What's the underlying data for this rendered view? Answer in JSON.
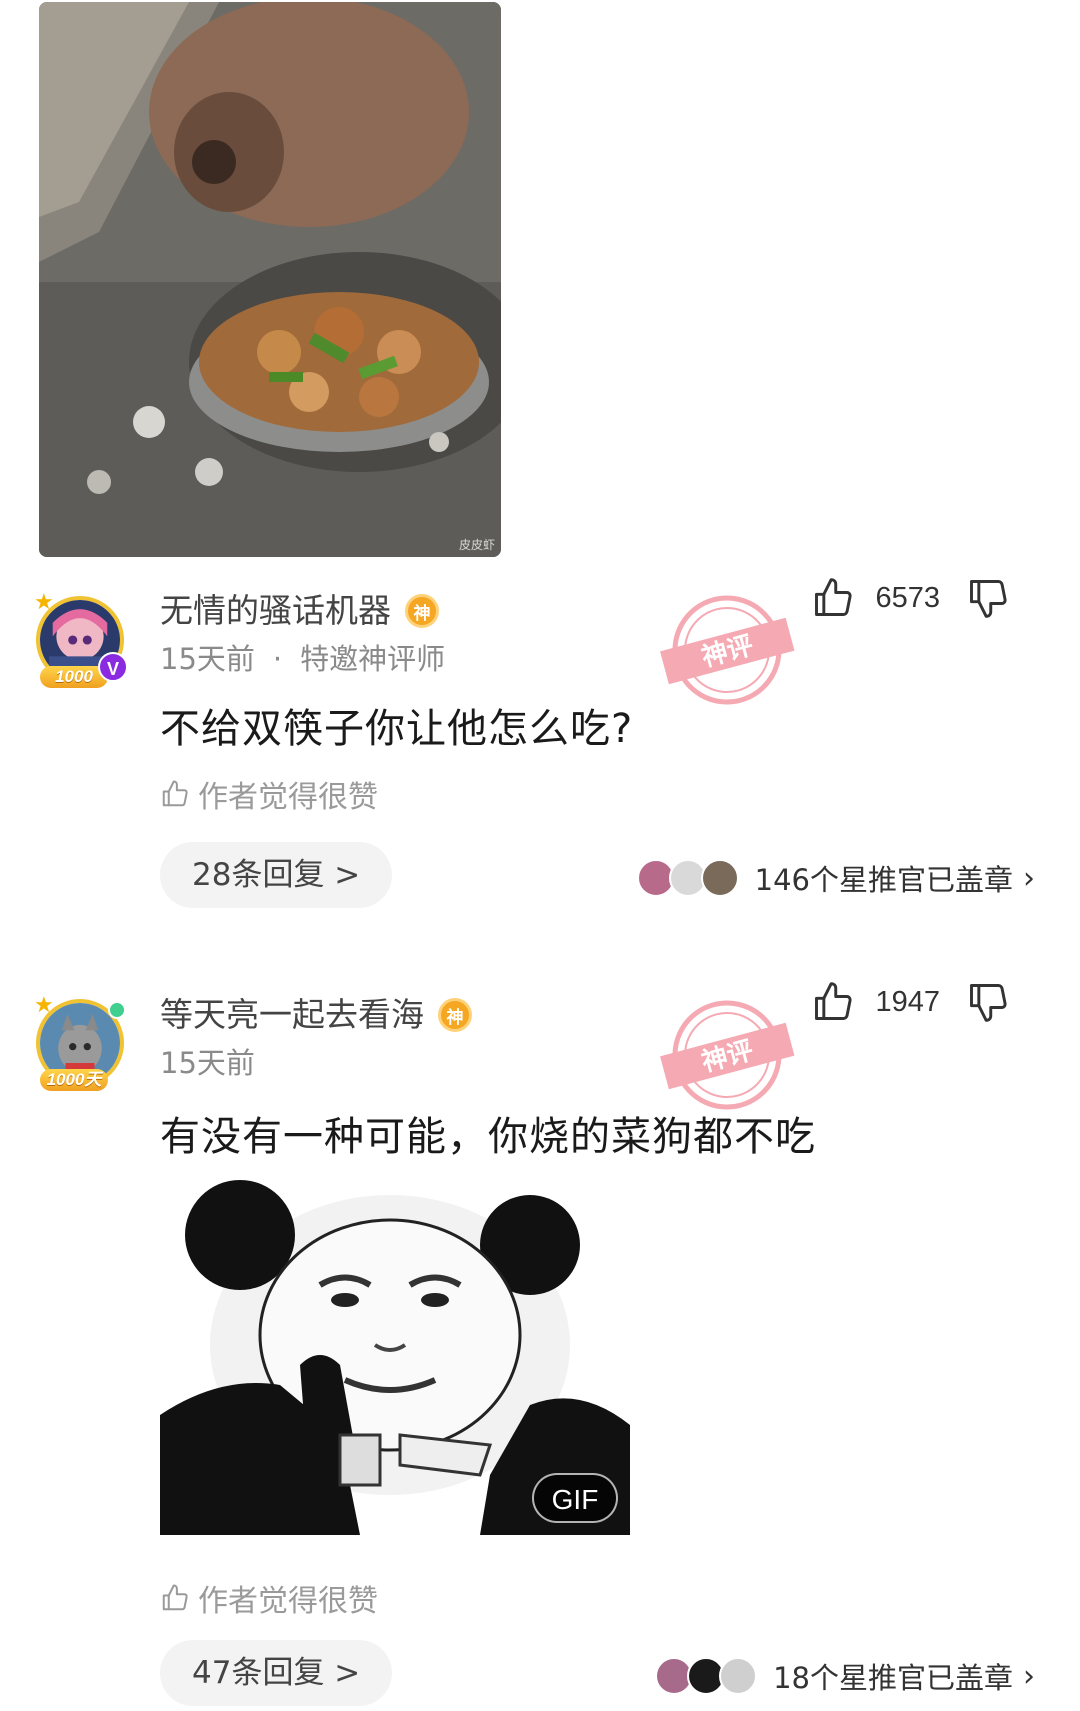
{
  "photo": {
    "watermark": "皮皮虾"
  },
  "comments": [
    {
      "username": "无情的骚话机器",
      "badge": "神",
      "avatar_badge": "1000",
      "vip": "V",
      "time": "15天前",
      "tag": "特邀神评师",
      "separator": "·",
      "text": "不给双筷子你让他怎么吃?",
      "likes": "6573",
      "stamp_text": "神评",
      "author_liked": "作者觉得很赞",
      "replies": "28条回复 >",
      "stampers": "146个星推官已盖章",
      "chevron": "›"
    },
    {
      "username": "等天亮一起去看海",
      "badge": "神",
      "avatar_badge": "1000天",
      "time": "15天前",
      "text": "有没有一种可能，你烧的菜狗都不吃",
      "likes": "1947",
      "stamp_text": "神评",
      "gif_label": "GIF",
      "author_liked": "作者觉得很赞",
      "replies": "47条回复 >",
      "stampers": "18个星推官已盖章",
      "chevron": "›"
    }
  ],
  "colors": {
    "accent_gold": "#f5a623",
    "stamp_red": "#e8354a",
    "pill_bg": "#f3f3f3"
  }
}
